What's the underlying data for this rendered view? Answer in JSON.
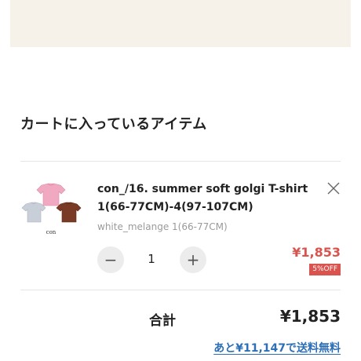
{
  "cart": {
    "heading": "カートに入っているアイテム"
  },
  "item": {
    "name": "con_/16. summer soft golgi T-shirt 1(66-77CM)-4(97-107CM)",
    "variant": "white_melange 1(66-77CM)",
    "quantity": "1",
    "minus_symbol": "−",
    "plus_symbol": "+",
    "price": "¥1,853",
    "discount": "5%OFF",
    "thumbnail_caption": "con"
  },
  "summary": {
    "total_label": "合計",
    "total_value": "¥1,853",
    "free_shipping_text": "あと¥11,147で送料無料"
  },
  "colors": {
    "price_red": "#d9534f",
    "link_blue": "#2d6fb7",
    "banner_beige": "#f6f2ea"
  }
}
